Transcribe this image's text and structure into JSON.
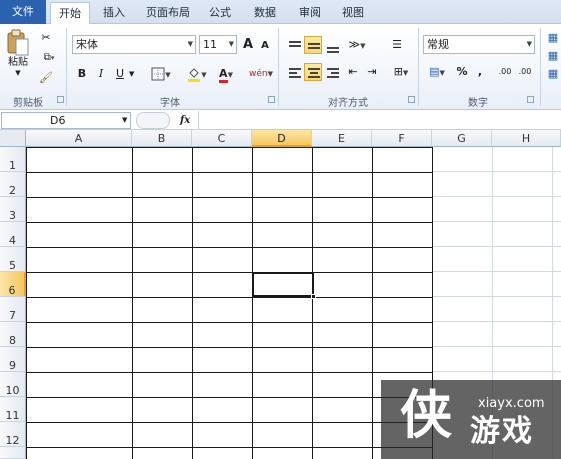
{
  "tabs": [
    {
      "id": "file",
      "label": "文件"
    },
    {
      "id": "home",
      "label": "开始"
    },
    {
      "id": "insert",
      "label": "插入"
    },
    {
      "id": "layout",
      "label": "页面布局"
    },
    {
      "id": "formula",
      "label": "公式"
    },
    {
      "id": "data",
      "label": "数据"
    },
    {
      "id": "review",
      "label": "审阅"
    },
    {
      "id": "view",
      "label": "视图"
    }
  ],
  "ribbon": {
    "clipboard": {
      "label": "剪贴板",
      "paste_label": "粘贴"
    },
    "font": {
      "label": "字体",
      "font_name": "宋体",
      "font_size": "11",
      "bold": "B",
      "italic": "I",
      "underline": "U",
      "grow": "A",
      "shrink": "A",
      "font_color": "A",
      "phonetic": "wén"
    },
    "alignment": {
      "label": "对齐方式"
    },
    "number": {
      "label": "数字",
      "format": "常规",
      "percent": "%",
      "comma": ",",
      "inc_decimal": ".00",
      "dec_decimal": ".00"
    }
  },
  "formula_bar": {
    "name_box": "D6",
    "fx": "fx",
    "value": ""
  },
  "columns": [
    "A",
    "B",
    "C",
    "D",
    "E",
    "F",
    "G",
    "H"
  ],
  "rows": [
    "1",
    "2",
    "3",
    "4",
    "5",
    "6",
    "7",
    "8",
    "9",
    "10",
    "11",
    "12"
  ],
  "selection": {
    "cell": "D6",
    "column": "D",
    "row": "6"
  },
  "colors": {
    "file_tab": "#2a62b0",
    "selected_header": "#f5c85e",
    "border": "#1a1a1a"
  },
  "watermark": {
    "logo": "侠",
    "site": "xiayx.com",
    "text": "游戏"
  }
}
